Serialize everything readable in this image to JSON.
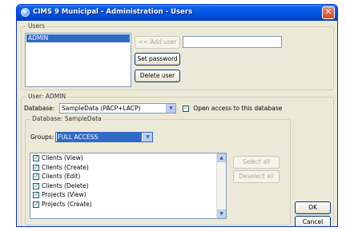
{
  "window": {
    "title": "CIMS 9 Municipal - Administration - Users"
  },
  "users": {
    "legend": "Users",
    "list": [
      "ADMIN"
    ],
    "add_user_label": "<< Add user",
    "set_password_label": "Set password",
    "delete_user_label": "Delete user",
    "new_user_value": ""
  },
  "user": {
    "legend": "User: ADMIN",
    "database_label": "Database:",
    "database_value": "SampleData (PACP+LACP)",
    "open_access_label": "Open access to this database",
    "open_access_checked": true
  },
  "database": {
    "legend": "Database: SampleData",
    "groups_label": "Groups:",
    "groups_value": "FULL ACCESS",
    "permissions": [
      "Clients (View)",
      "Clients (Create)",
      "Clients (Edit)",
      "Clients (Delete)",
      "Projects (View)",
      "Projects (Create)"
    ],
    "select_all_label": "Select all",
    "deselect_all_label": "Deselect all"
  },
  "footer": {
    "ok_label": "OK",
    "cancel_label": "Cancel"
  },
  "colors": {
    "titlebar": "#0055e5",
    "selection": "#316ac5",
    "dialog_bg": "#ece9d8"
  }
}
